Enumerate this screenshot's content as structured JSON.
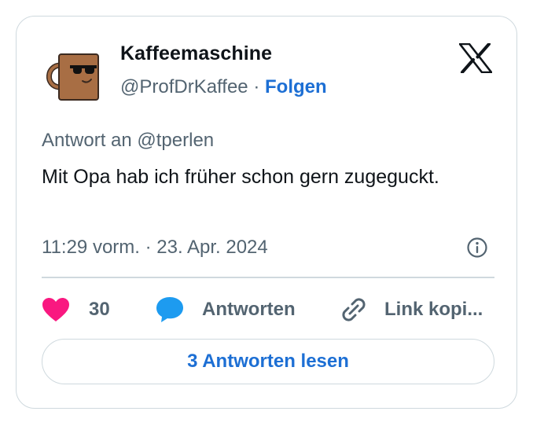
{
  "author": {
    "name": "Kaffeemaschine",
    "handle": "@ProfDrKaffee",
    "separator": "·",
    "follow_label": "Folgen",
    "avatar_icon": "coffee-mug-sunglasses-icon"
  },
  "brand": {
    "logo_icon": "x-logo-icon"
  },
  "tweet": {
    "reply_to": "Antwort an @tperlen",
    "text": "Mit Opa hab ich früher schon gern zugeguckt.",
    "timestamp": "11:29 vorm. · 23. Apr. 2024"
  },
  "actions": {
    "like_count": "30",
    "reply_label": "Antworten",
    "copy_link_label": "Link kopi..."
  },
  "read_replies_label": "3 Antworten lesen",
  "colors": {
    "accent": "#1d6fd4",
    "like": "#f91880",
    "reply_bubble": "#1d9bf0",
    "muted": "#536471",
    "border": "#cfd9de",
    "mug": "#a86e44"
  }
}
